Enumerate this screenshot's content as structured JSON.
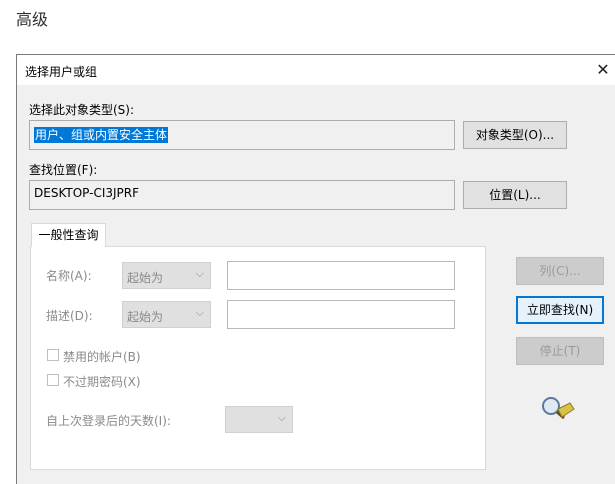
{
  "background": {
    "title": "高级"
  },
  "dialog": {
    "title": "选择用户或组",
    "close_glyph": "✕",
    "object_type": {
      "label": "选择此对象类型(S):",
      "value": "用户、组或内置安全主体",
      "button": "对象类型(O)..."
    },
    "location": {
      "label": "查找位置(F):",
      "value": "DESKTOP-CI3JPRF",
      "button": "位置(L)..."
    },
    "tab": {
      "label": "一般性查询"
    },
    "query": {
      "name_label": "名称(A):",
      "name_combo": "起始为",
      "desc_label": "描述(D):",
      "desc_combo": "起始为",
      "disabled_accounts": "禁用的帐户(B)",
      "non_expiring_pw": "不过期密码(X)",
      "days_label": "自上次登录后的天数(I):"
    },
    "buttons": {
      "columns": "列(C)...",
      "find_now": "立即查找(N)",
      "stop": "停止(T)"
    },
    "icons": {
      "search": "search-flashlight-icon",
      "close": "close-icon",
      "dropdown": "chevron-down-icon"
    }
  }
}
